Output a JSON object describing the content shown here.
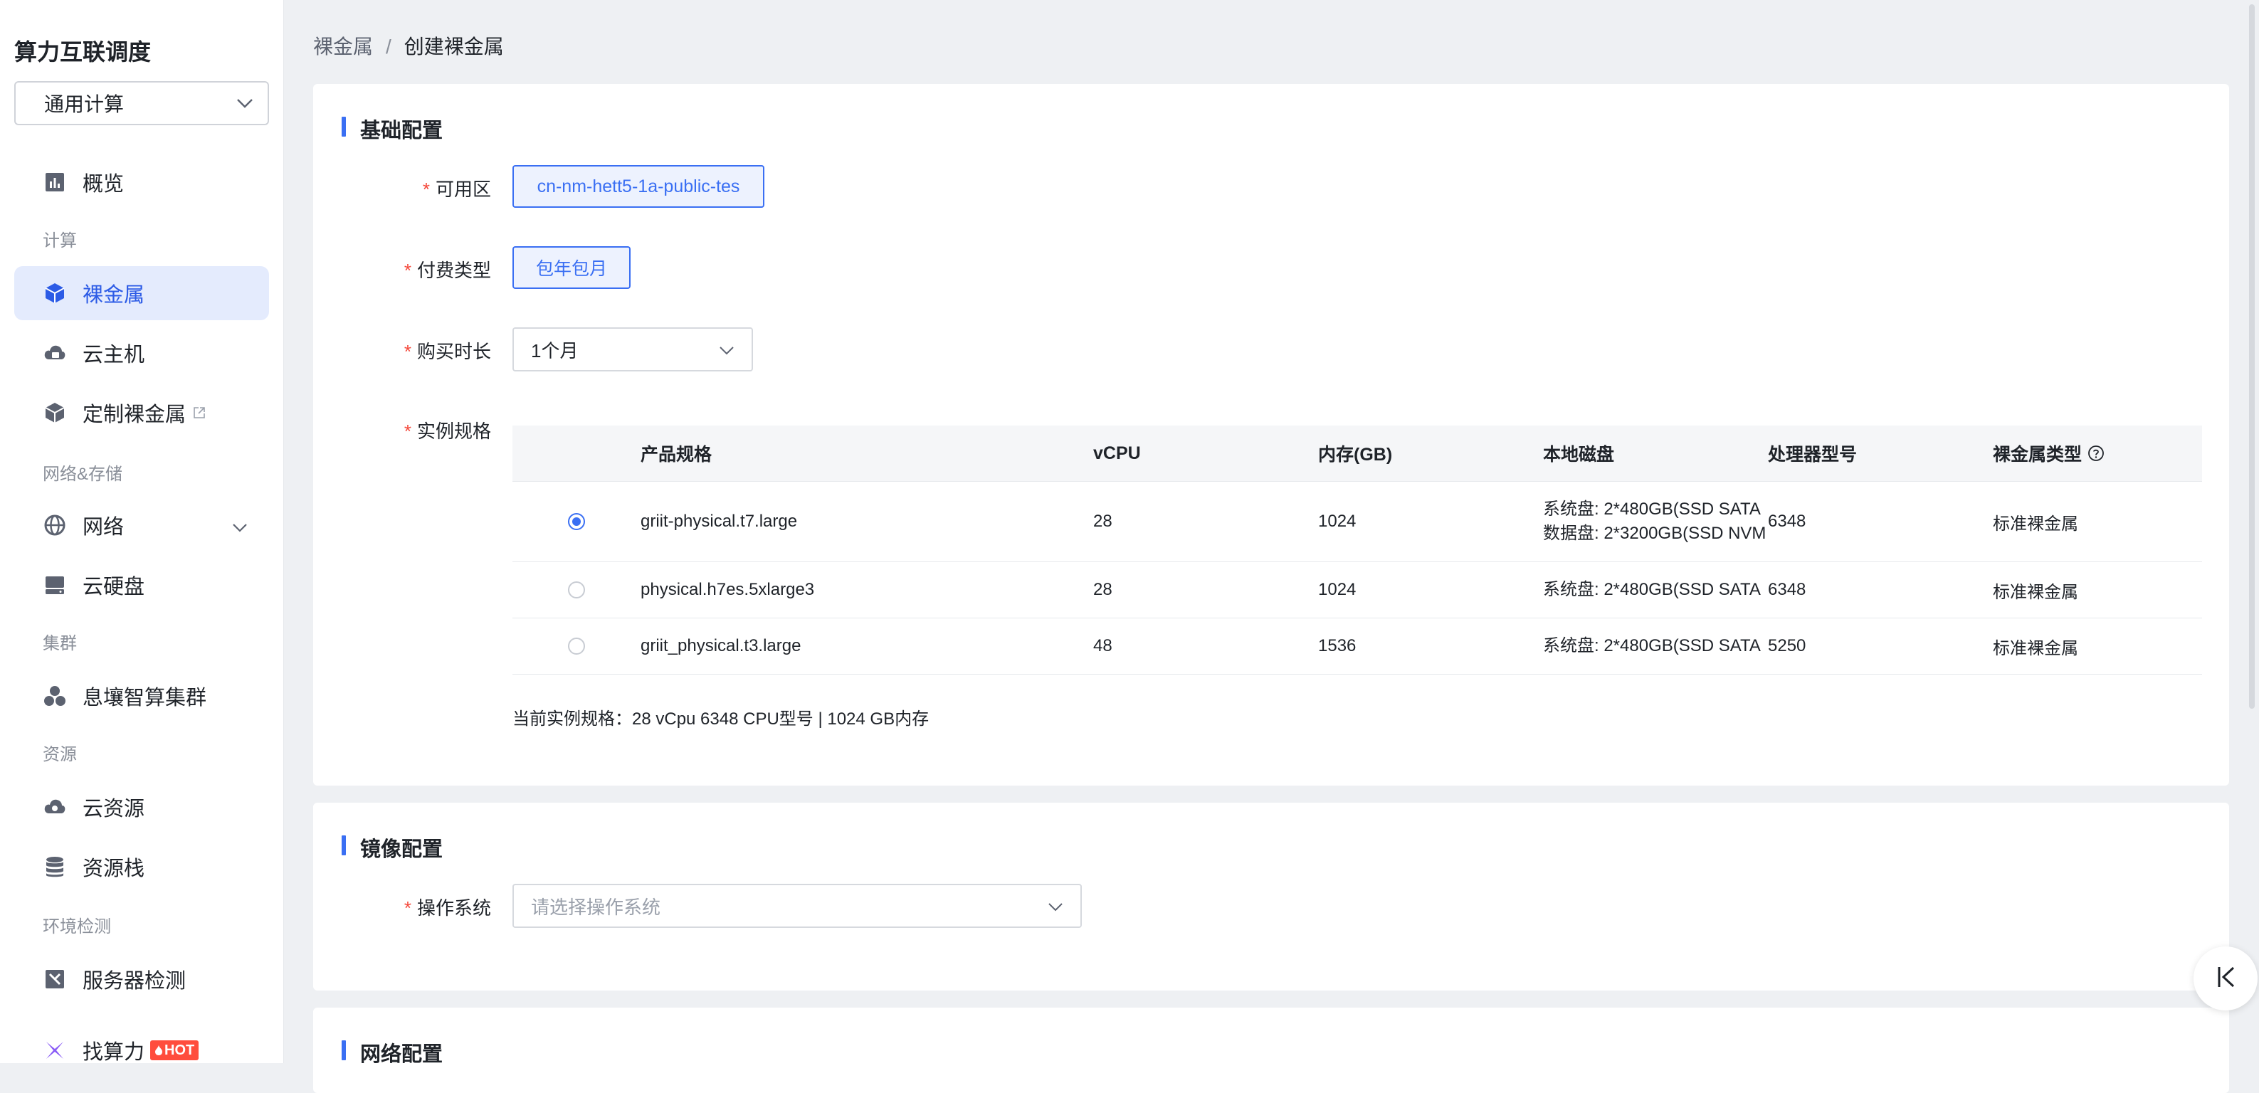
{
  "app": {
    "title": "算力互联调度"
  },
  "region_select": {
    "value": "通用计算"
  },
  "nav": {
    "overview": "概览",
    "group_compute": "计算",
    "bare_metal": "裸金属",
    "cloud_host": "云主机",
    "custom_bare_metal": "定制裸金属",
    "group_network_storage": "网络&存储",
    "network": "网络",
    "cloud_disk": "云硬盘",
    "group_cluster": "集群",
    "cluster": "息壤智算集群",
    "group_resources": "资源",
    "cloud_resources": "云资源",
    "resource_stack": "资源栈",
    "group_env_check": "环境检测",
    "server_check": "服务器检测",
    "find_compute": "找算力",
    "hot_badge": "HOT"
  },
  "breadcrumb": {
    "parent": "裸金属",
    "separator": "/",
    "current": "创建裸金属"
  },
  "basic_config": {
    "title": "基础配置",
    "zone_label": "可用区",
    "zone_value": "cn-nm-hett5-1a-public-tes",
    "billing_label": "付费类型",
    "billing_value": "包年包月",
    "duration_label": "购买时长",
    "duration_value": "1个月",
    "spec_label": "实例规格",
    "required_mark": "*"
  },
  "spec_table": {
    "headers": [
      "产品规格",
      "vCPU",
      "内存(GB)",
      "本地磁盘",
      "处理器型号",
      "裸金属类型"
    ],
    "rows": [
      {
        "selected": true,
        "name": "griit-physical.t7.large",
        "vcpu": "28",
        "memory": "1024",
        "disk": [
          "系统盘: 2*480GB(SSD SATA",
          "数据盘: 2*3200GB(SSD NVM"
        ],
        "cpu": "6348",
        "type": "标准裸金属"
      },
      {
        "selected": false,
        "name": "physical.h7es.5xlarge3",
        "vcpu": "28",
        "memory": "1024",
        "disk": [
          "系统盘: 2*480GB(SSD SATA"
        ],
        "cpu": "6348",
        "type": "标准裸金属"
      },
      {
        "selected": false,
        "name": "griit_physical.t3.large",
        "vcpu": "48",
        "memory": "1536",
        "disk": [
          "系统盘: 2*480GB(SSD SATA"
        ],
        "cpu": "5250",
        "type": "标准裸金属"
      }
    ]
  },
  "summary": "当前实例规格：28 vCpu 6348 CPU型号 | 1024 GB内存",
  "image_config": {
    "title": "镜像配置",
    "os_label": "操作系统",
    "os_placeholder": "请选择操作系统"
  },
  "network_config": {
    "title": "网络配置"
  },
  "colors": {
    "accent": "#3a6ff3",
    "active_bg": "#e4ebfd",
    "required": "#f5483b",
    "hot": "#ff4d3d"
  }
}
